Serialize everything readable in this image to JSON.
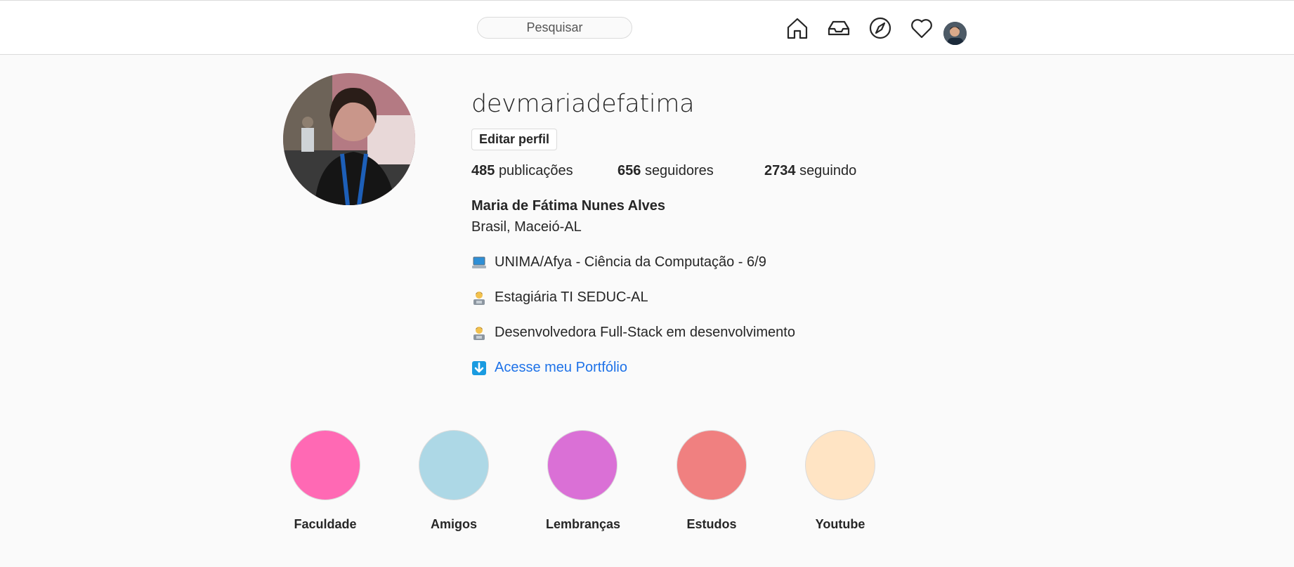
{
  "header": {
    "search_placeholder": "Pesquisar",
    "icons": [
      "home-icon",
      "inbox-icon",
      "explore-icon",
      "activity-heart-icon",
      "profile-avatar"
    ]
  },
  "profile": {
    "username": "devmariadefatima",
    "edit_label": "Editar perfil",
    "stats": {
      "posts_count": "485",
      "posts_label": "publicações",
      "followers_count": "656",
      "followers_label": "seguidores",
      "following_count": "2734",
      "following_label": "seguindo"
    },
    "full_name": "Maria de Fátima Nunes Alves",
    "location": "Brasil, Maceió-AL",
    "bio": [
      {
        "icon": "laptop-icon",
        "text": "UNIMA/Afya - Ciência da Computação - 6/9"
      },
      {
        "icon": "technologist-icon",
        "text": "Estagiária TI SEDUC-AL"
      },
      {
        "icon": "technologist-icon",
        "text": "Desenvolvedora Full-Stack em desenvolvimento"
      },
      {
        "icon": "down-arrow-icon",
        "text": "Acesse meu Portfólio"
      }
    ]
  },
  "highlights": [
    {
      "label": "Faculdade",
      "color": "#ff69b4"
    },
    {
      "label": "Amigos",
      "color": "#add8e6"
    },
    {
      "label": "Lembranças",
      "color": "#da70d6"
    },
    {
      "label": "Estudos",
      "color": "#f08080"
    },
    {
      "label": "Youtube",
      "color": "#ffe4c4"
    }
  ]
}
